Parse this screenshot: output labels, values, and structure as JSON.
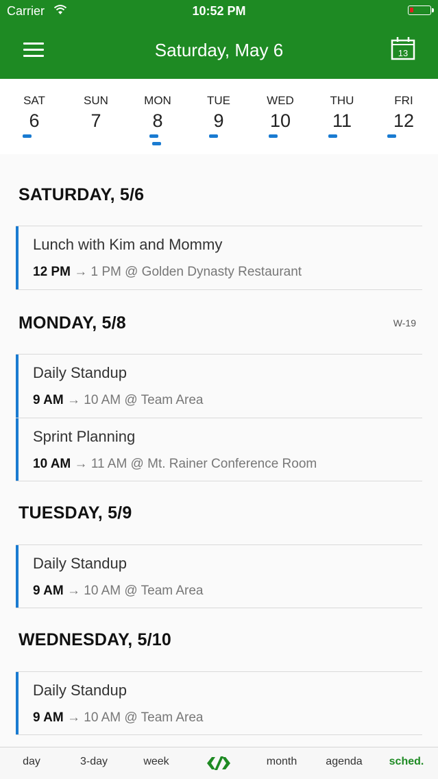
{
  "status_bar": {
    "carrier": "Carrier",
    "time": "10:52 PM",
    "battery_color": "#e02020"
  },
  "header": {
    "title": "Saturday, May 6",
    "calendar_icon_day": "13",
    "background": "#1e8a23"
  },
  "week": [
    {
      "name": "SAT",
      "num": "6",
      "dots": 1
    },
    {
      "name": "SUN",
      "num": "7",
      "dots": 0
    },
    {
      "name": "MON",
      "num": "8",
      "dots": 2
    },
    {
      "name": "TUE",
      "num": "9",
      "dots": 1
    },
    {
      "name": "WED",
      "num": "10",
      "dots": 1
    },
    {
      "name": "THU",
      "num": "11",
      "dots": 1
    },
    {
      "name": "FRI",
      "num": "12",
      "dots": 1
    }
  ],
  "schedule": {
    "saturday": {
      "header": "SATURDAY, 5/6",
      "events": [
        {
          "title": "Lunch with Kim and Mommy",
          "start": "12 PM",
          "rest": " → 1 PM @ Golden Dynasty Restaurant"
        }
      ]
    },
    "monday": {
      "header": "MONDAY, 5/8",
      "week_label": "W-19",
      "events": [
        {
          "title": "Daily Standup",
          "start": "9 AM",
          "rest": " → 10 AM @ Team Area"
        },
        {
          "title": "Sprint Planning",
          "start": "10 AM",
          "rest": " → 11 AM @ Mt. Rainer Conference Room"
        }
      ]
    },
    "tuesday": {
      "header": "TUESDAY, 5/9",
      "events": [
        {
          "title": "Daily Standup",
          "start": "9 AM",
          "rest": " → 10 AM @ Team Area"
        }
      ]
    },
    "wednesday": {
      "header": "WEDNESDAY, 5/10",
      "events": [
        {
          "title": "Daily Standup",
          "start": "9 AM",
          "rest": " → 10 AM @ Team Area"
        }
      ]
    }
  },
  "tabs": {
    "day": "day",
    "three_day": "3-day",
    "week": "week",
    "month": "month",
    "agenda": "agenda",
    "schedule": "sched.",
    "active": "schedule"
  },
  "colors": {
    "accent_green": "#1e8a23",
    "event_blue": "#1a7bd1"
  }
}
